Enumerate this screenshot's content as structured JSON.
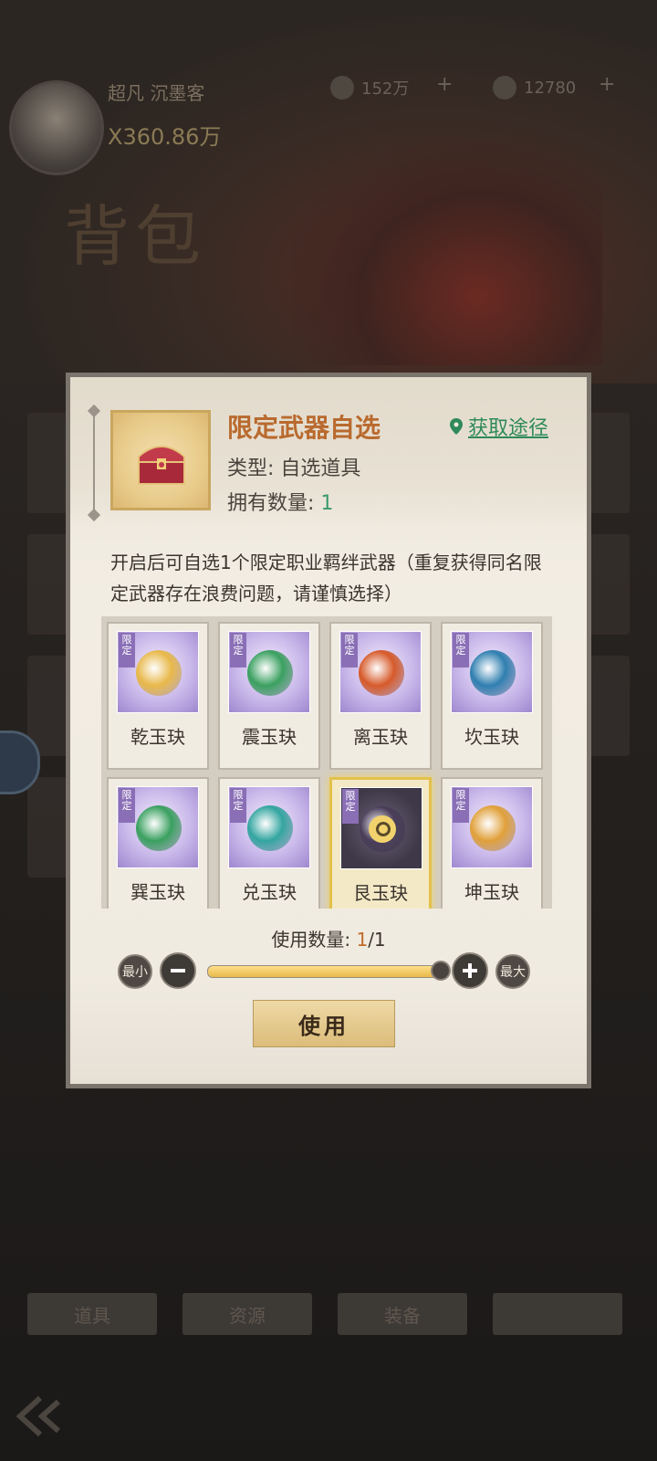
{
  "background": {
    "player_name": "超凡  沉墨客",
    "player_power": "X360.86万",
    "copper": "152万",
    "gold": "12780",
    "bag_title": "背包",
    "bottom_tabs": [
      "道具",
      "资源",
      "装备",
      ""
    ]
  },
  "dialog": {
    "item_name": "限定武器自选",
    "item_type": "类型: 自选道具",
    "own_label": "拥有数量: ",
    "own_count": "1",
    "source_link": "获取途径",
    "description": "开启后可自选1个限定职业羁绊武器（重复获得同名限定武器存在浪费问题，请谨慎选择）",
    "limited_tag": "限定",
    "options": [
      {
        "label": "乾玉玦",
        "color": "#e8b84a"
      },
      {
        "label": "震玉玦",
        "color": "#3aa060"
      },
      {
        "label": "离玉玦",
        "color": "#d65a2a"
      },
      {
        "label": "坎玉玦",
        "color": "#2f7fb0"
      },
      {
        "label": "巽玉玦",
        "color": "#3aa060"
      },
      {
        "label": "兑玉玦",
        "color": "#33a5a0"
      },
      {
        "label": "艮玉玦",
        "color": "#4a3e5a"
      },
      {
        "label": "坤玉玦",
        "color": "#e0a03a"
      }
    ],
    "selected_index": 6,
    "qty_label": "使用数量:",
    "qty_current": "1",
    "qty_total": "/1",
    "qty_fraction": 1.0,
    "min_label": "最小",
    "max_label": "最大",
    "use_label": "使用"
  },
  "colors": {
    "accent": "#b96a2e",
    "link": "#2f8a5a",
    "selected_border": "#e3c14c"
  }
}
